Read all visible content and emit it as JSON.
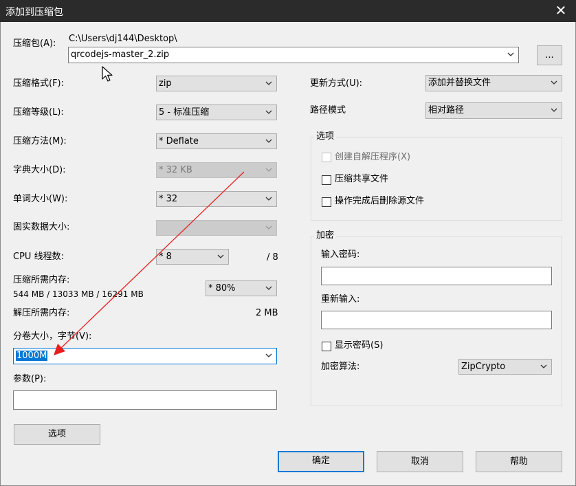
{
  "window": {
    "title": "添加到压缩包"
  },
  "archive": {
    "label": "压缩包(A):",
    "path": "C:\\Users\\dj144\\Desktop\\",
    "filename": "qrcodejs-master_2.zip",
    "browse_label": "..."
  },
  "left": {
    "format_label": "压缩格式(F):",
    "format_value": "zip",
    "level_label": "压缩等级(L):",
    "level_value": "5 - 标准压缩",
    "method_label": "压缩方法(M):",
    "method_value": "* Deflate",
    "dict_label": "字典大小(D):",
    "dict_value": "* 32 KB",
    "word_label": "单词大小(W):",
    "word_value": "* 32",
    "solid_label": "固实数据大小:",
    "solid_value": "",
    "cpu_label": "CPU 线程数:",
    "cpu_value": "* 8",
    "cpu_max": "/ 8",
    "mem_compress_label": "压缩所需内存:",
    "mem_compress_detail": "544 MB / 13033 MB / 16291 MB",
    "mem_percent_value": "* 80%",
    "mem_decompress_label": "解压所需内存:",
    "mem_decompress_value": "2 MB",
    "volume_label": "分卷大小，字节(V):",
    "volume_value": "1000M",
    "params_label": "参数(P):",
    "params_value": "",
    "options_button": "选项"
  },
  "right": {
    "update_label": "更新方式(U):",
    "update_value": "添加并替换文件",
    "path_label": "路径模式",
    "path_value": "相对路径",
    "options_group": "选项",
    "sfx_label": "创建自解压程序(X)",
    "shared_label": "压缩共享文件",
    "delete_label": "操作完成后删除源文件",
    "encrypt_group": "加密",
    "password_label": "输入密码:",
    "reenter_label": "重新输入:",
    "show_password_label": "显示密码(S)",
    "algo_label": "加密算法:",
    "algo_value": "ZipCrypto"
  },
  "buttons": {
    "ok": "确定",
    "cancel": "取消",
    "help": "帮助"
  },
  "colors": {
    "titlebar": "#2b2b2b",
    "dialog_bg": "#f0f0f0",
    "accent": "#0078d7",
    "annotation_arrow": "#e81e1e"
  }
}
